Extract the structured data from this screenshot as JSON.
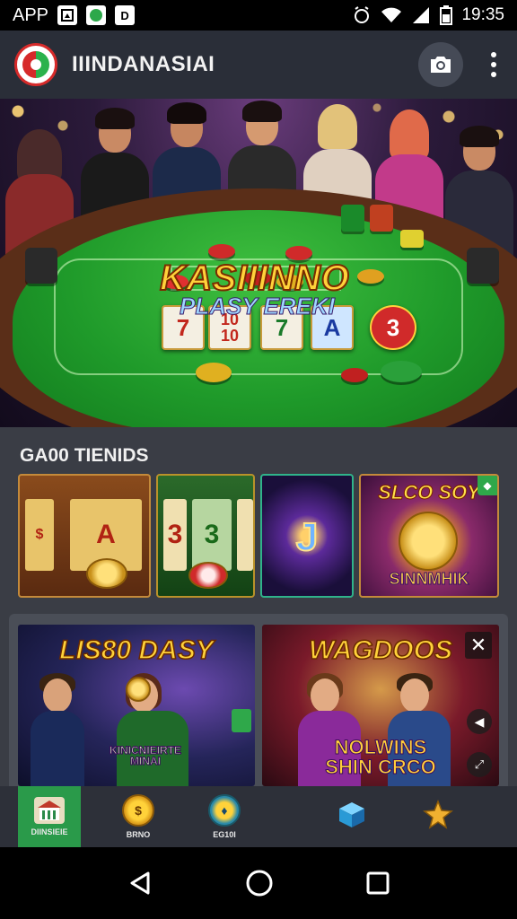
{
  "status_bar": {
    "app_label": "APP",
    "badge_1": "",
    "badge_3": "D",
    "time": "19:35"
  },
  "app_bar": {
    "title": "IIINDANASIAI",
    "icons": [
      "logo-icon",
      "camera-icon",
      "more-vert-icon"
    ]
  },
  "hero": {
    "title": "KASIIINNO",
    "subtitle": "PLASY EREKI",
    "cards": [
      "7",
      "10\n10",
      "7",
      "A",
      "3"
    ]
  },
  "section": {
    "label": "GA00 TIENIDS"
  },
  "tiles": [
    {
      "kind": "slot-a",
      "symbol": "A"
    },
    {
      "kind": "slot-3",
      "symbol": "3"
    },
    {
      "kind": "jackpot-j",
      "symbol": "J"
    },
    {
      "kind": "promo",
      "top": "SLCO SOY",
      "bottom": "SINNMHIK"
    }
  ],
  "promos": [
    {
      "title": "LIS80 DASY",
      "sub": "KINICNIEIRTE MINAI"
    },
    {
      "title": "WAGDOOS",
      "sub": "NOLWINS SHIN CRCO"
    }
  ],
  "bottom_nav": [
    {
      "label": "DIINSIEIE",
      "icon": "store-icon",
      "active": true
    },
    {
      "label": "BRNO",
      "icon": "coin-icon",
      "active": false
    },
    {
      "label": "EG10I",
      "icon": "bonus-icon",
      "active": false
    },
    {
      "label": "",
      "icon": "cube-icon",
      "active": false
    },
    {
      "label": "",
      "icon": "star-icon",
      "active": false
    }
  ],
  "colors": {
    "app_bar": "#2a2e38",
    "content_bg": "#3a3d45",
    "active_nav": "#2a9a4a",
    "title_gold": "#ffd23a"
  }
}
